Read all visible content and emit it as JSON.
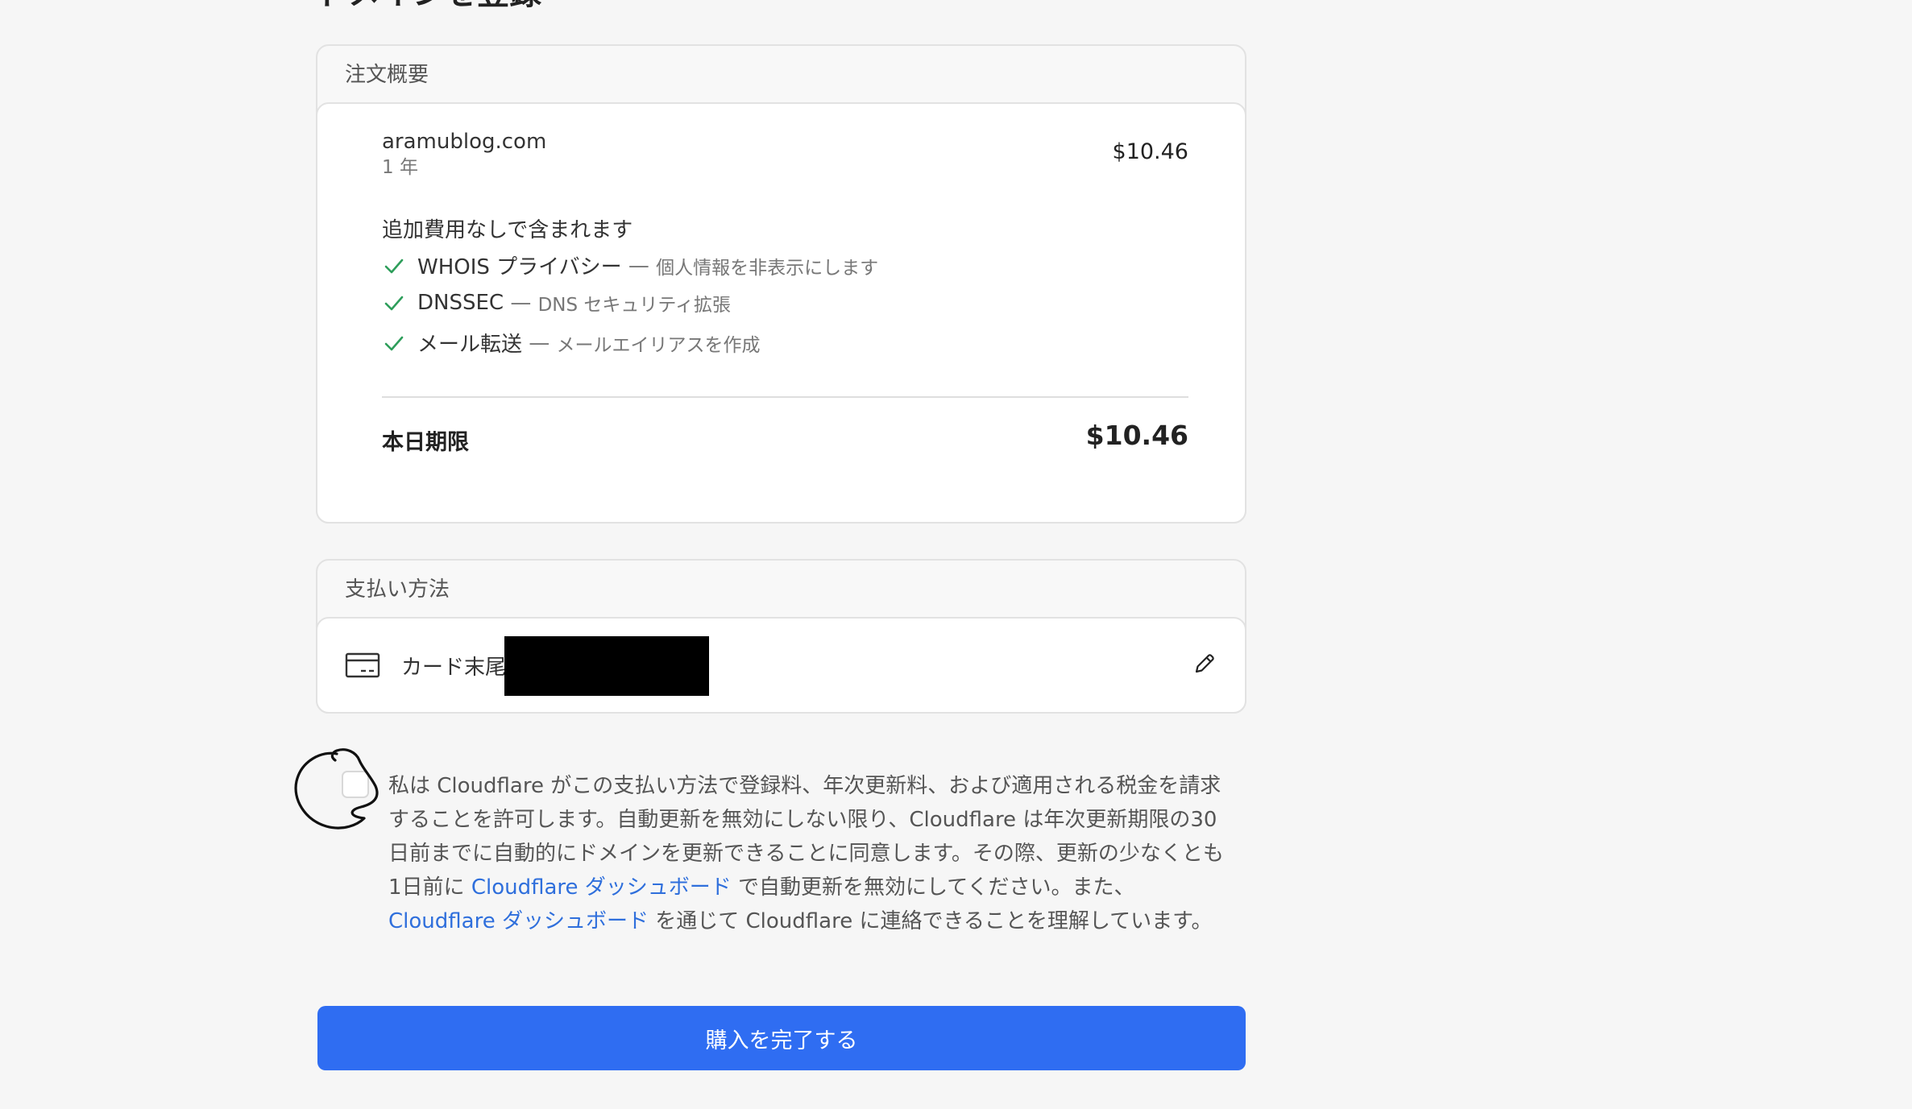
{
  "page": {
    "title": "ドメインを登録"
  },
  "order_summary": {
    "header": "注文概要",
    "domain": "aramublog.com",
    "term": "1 年",
    "price": "$10.46",
    "included_heading": "追加費用なしで含まれます",
    "features": [
      {
        "name": "WHOIS プライバシー",
        "separator": "—",
        "description": "個人情報を非表示にします"
      },
      {
        "name": "DNSSEC",
        "separator": "—",
        "description": "DNS セキュリティ拡張"
      },
      {
        "name": "メール転送",
        "separator": "—",
        "description": "メールエイリアスを作成"
      }
    ],
    "total_label": "本日期限",
    "total_value": "$10.46"
  },
  "payment": {
    "header": "支払い方法",
    "card_text": "カード末尾"
  },
  "consent": {
    "text_1": "私は Cloudflare がこの支払い方法で登録料、年次更新料、および適用される税金を請求することを許可します。自動更新を無効にしない限り、Cloudflare は年次更新期限の30日前までに自動的にドメインを更新できることに同意します。その際、更新の少なくとも1日前に ",
    "link_1": "Cloudflare ダッシュボード",
    "text_2": " で自動更新を無効にしてください。また、",
    "link_2": "Cloudflare ダッシュボード",
    "text_3": " を通じて Cloudflare に連絡できることを理解しています。"
  },
  "actions": {
    "complete_label": "購入を完了する"
  },
  "colors": {
    "accent": "#2f6df2",
    "link": "#2f6fdc",
    "check": "#2e9e5b"
  }
}
